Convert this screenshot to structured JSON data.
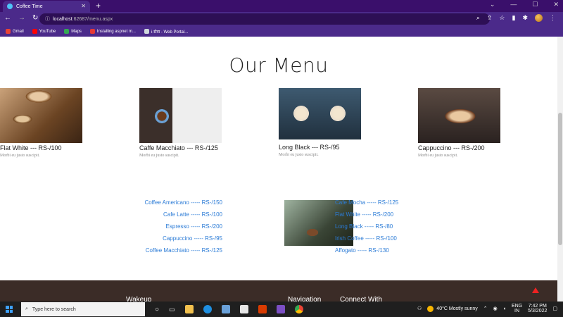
{
  "browser": {
    "tab_title": "Coffee Time",
    "new_tab_symbol": "+",
    "url_host": "localhost",
    "url_path": ":62687/menu.aspx",
    "bookmarks": [
      {
        "label": "Gmail",
        "color": "#ea4335"
      },
      {
        "label": "YouTube",
        "color": "#ff0000"
      },
      {
        "label": "Maps",
        "color": "#34a853"
      },
      {
        "label": "Installing aspnet m...",
        "color": "#e53935"
      },
      {
        "label": "i-सेवा - Web Portal...",
        "color": "#cfd8dc"
      }
    ]
  },
  "page": {
    "title": "Our Menu",
    "featured": [
      {
        "name": "Flat White --- RS-/100",
        "desc": "Morbi eu justo suscipit."
      },
      {
        "name": "Caffe Macchiato --- RS-/125",
        "desc": "Morbi eu justo suscipit."
      },
      {
        "name": "Long Black --- RS-/95",
        "desc": "Morbi eu justo suscipit."
      },
      {
        "name": "Cappuccino --- RS-/200",
        "desc": "Morbi eu justo suscipit."
      }
    ],
    "menu_left": [
      "Coffee Americano ----- RS-/150",
      "Cafe Latte ----- RS-/100",
      "Espresso ----- RS-/200",
      "Cappuccino ----- RS-/95",
      "Coffee Macchiato ----- RS-/125"
    ],
    "menu_right": [
      "Cafe Mocha ----- RS-/125",
      "Flat White ----- RS-/200",
      "Long Black ----- RS-/80",
      "Irish Coffee ----- RS-/100",
      "Affogato ----- RS-/130"
    ],
    "footer": {
      "col1": "Wakeup",
      "col2": "Navigation",
      "col3": "Connect With"
    }
  },
  "taskbar": {
    "search_placeholder": "Type here to search",
    "weather": "40°C  Mostly sunny",
    "lang_top": "ENG",
    "lang_bottom": "IN",
    "time": "7:42 PM",
    "date": "5/3/2022"
  }
}
